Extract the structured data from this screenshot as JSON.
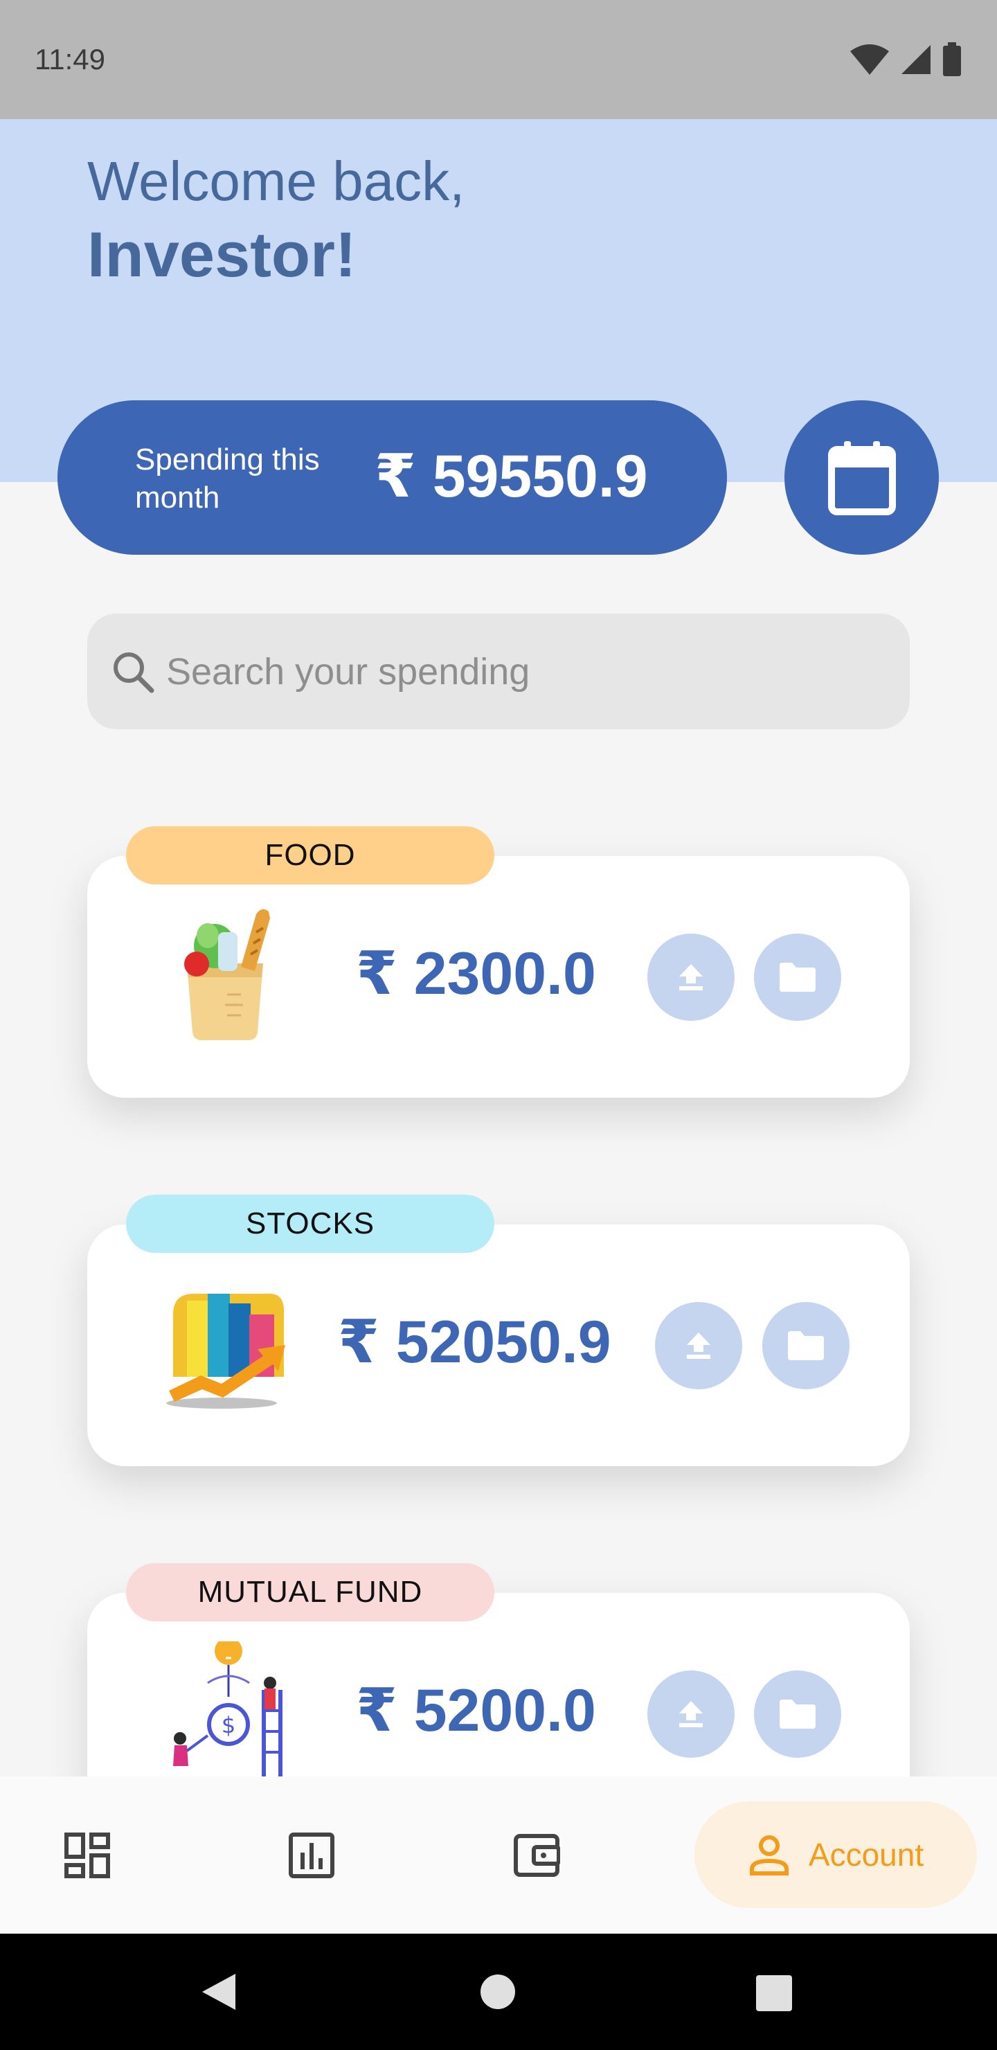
{
  "status_bar": {
    "time": "11:49"
  },
  "header": {
    "greeting": "Welcome back,",
    "name": "Investor!"
  },
  "spending": {
    "label": "Spending this month",
    "amount": "₹ 59550.9"
  },
  "search": {
    "placeholder": "Search your spending"
  },
  "categories": [
    {
      "tag": "FOOD",
      "amount": "₹ 2300.0",
      "tag_color": "#ffd08a"
    },
    {
      "tag": "STOCKS",
      "amount": "₹ 52050.9",
      "tag_color": "#b4edf8"
    },
    {
      "tag": "MUTUAL FUND",
      "amount": "₹ 5200.0",
      "tag_color": "#fad9d9"
    }
  ],
  "bottom_nav": {
    "items": [
      {
        "icon": "dashboard-icon"
      },
      {
        "icon": "bar-chart-icon"
      },
      {
        "icon": "wallet-icon"
      },
      {
        "icon": "person-icon",
        "label": "Account",
        "active": true
      }
    ]
  },
  "colors": {
    "accent": "#3d66b5",
    "header": "#c9daf6",
    "active_nav": "#f39c1a"
  }
}
